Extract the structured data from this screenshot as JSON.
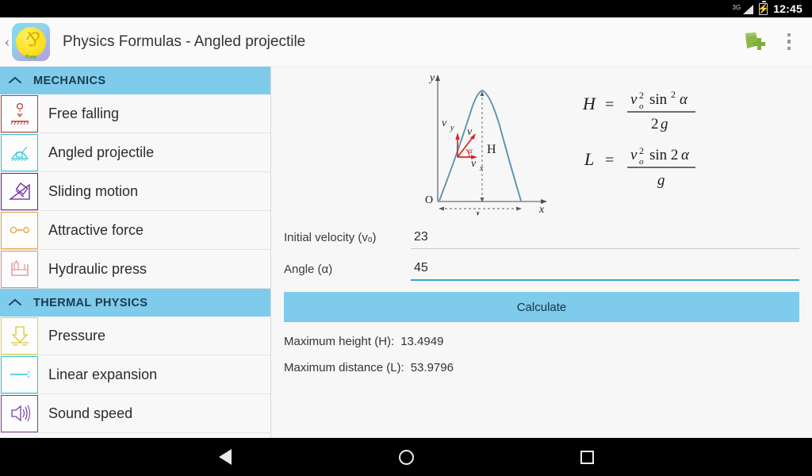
{
  "statusbar": {
    "network_label": "3G",
    "time": "12:45",
    "signal_icon": "signal-3g-icon",
    "battery_icon": "battery-charging-icon"
  },
  "appbar": {
    "back_chevron": "‹",
    "app_icon": "physics-formulas-app-icon",
    "app_icon_badge": "Free",
    "title": "Physics Formulas - Angled projectile",
    "actions": [
      {
        "name": "add-note-icon",
        "label": ""
      },
      {
        "name": "overflow-menu-icon",
        "label": ""
      }
    ]
  },
  "sidebar": {
    "sections": [
      {
        "title": "MECHANICS",
        "collapse_chevron": "⌃",
        "items": [
          {
            "label": "Free falling",
            "icon": "free-falling-icon",
            "color": "#c0392b"
          },
          {
            "label": "Angled projectile",
            "icon": "angled-projectile-icon",
            "color": "#2ec5d3"
          },
          {
            "label": "Sliding motion",
            "icon": "sliding-motion-icon",
            "color": "#6a1b9a"
          },
          {
            "label": "Attractive force",
            "icon": "attractive-force-icon",
            "color": "#e8a33d"
          },
          {
            "label": "Hydraulic press",
            "icon": "hydraulic-press-icon",
            "color": "#e08a8a"
          }
        ]
      },
      {
        "title": "THERMAL PHYSICS",
        "collapse_chevron": "⌃",
        "items": [
          {
            "label": "Pressure",
            "icon": "pressure-icon",
            "color": "#e3d233"
          },
          {
            "label": "Linear expansion",
            "icon": "linear-expansion-icon",
            "color": "#2ec5d3"
          },
          {
            "label": "Sound speed",
            "icon": "sound-speed-icon",
            "color": "#7b3fa0"
          }
        ]
      }
    ]
  },
  "diagram": {
    "name": "angled-projectile-trajectory-diagram",
    "axis_y": "y",
    "axis_x": "x",
    "origin": "O",
    "height_label": "H",
    "distance_label": "L",
    "vector_v": "v",
    "vector_vx": "v",
    "vector_vy": "v",
    "sub_x": "x",
    "sub_y": "y",
    "angle_symbol": "α",
    "curve_color": "#6a9cb5",
    "vector_color": "#e02020"
  },
  "formulas": {
    "height": {
      "lhs": "H",
      "eq": "=",
      "numerator": "vₒ² sin² α",
      "denominator": "2g"
    },
    "distance": {
      "lhs": "L",
      "eq": "=",
      "numerator": "vₒ² sin 2α",
      "denominator": "g"
    }
  },
  "form": {
    "velocity": {
      "label": "Initial velocity (vₒ)",
      "value": "23",
      "focused": false
    },
    "angle": {
      "label": "Angle (α)",
      "value": "45",
      "focused": true
    },
    "calculate_label": "Calculate",
    "accent_color": "#7ecbeb",
    "focus_color": "#21b2c4"
  },
  "results": [
    {
      "label": "Maximum height (H):",
      "value": "13.4949"
    },
    {
      "label": "Maximum distance (L):",
      "value": "53.9796"
    }
  ],
  "navbar": {
    "back": "back-button",
    "home": "home-button",
    "recents": "recents-button"
  }
}
